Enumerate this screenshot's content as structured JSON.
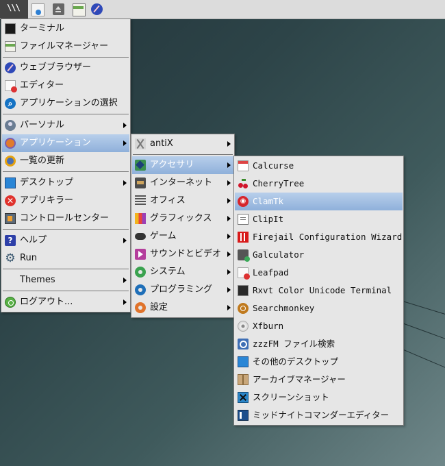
{
  "taskbar": {
    "start_icon": "menu-logo-icon",
    "launchers": [
      "file-manager-icon",
      "eject-icon",
      "terminal-launcher-icon",
      "browser-launcher-icon"
    ]
  },
  "main_menu": {
    "items": [
      {
        "label": "ターミナル",
        "icon": "terminal-icon"
      },
      {
        "label": "ファイルマネージャー",
        "icon": "file-manager-icon"
      },
      {
        "label": "ウェブブラウザー",
        "icon": "web-browser-icon"
      },
      {
        "label": "エディター",
        "icon": "editor-icon"
      },
      {
        "label": "アプリケーションの選択",
        "icon": "app-select-icon"
      },
      {
        "label": "パーソナル",
        "icon": "personal-icon"
      },
      {
        "label": "アプリケーション",
        "icon": "applications-icon"
      },
      {
        "label": "一覧の更新",
        "icon": "refresh-icon"
      },
      {
        "label": "デスクトップ",
        "icon": "desktop-icon"
      },
      {
        "label": "アプリキラー",
        "icon": "app-killer-icon"
      },
      {
        "label": "コントロールセンター",
        "icon": "control-center-icon"
      },
      {
        "label": "ヘルプ",
        "icon": "help-icon"
      },
      {
        "label": "Run",
        "icon": "run-gear-icon"
      },
      {
        "label": "Themes",
        "icon": ""
      },
      {
        "label": "ログアウト...",
        "icon": "logout-icon"
      }
    ]
  },
  "apps_menu": {
    "items": [
      {
        "label": "antiX",
        "icon": "antix-icon"
      },
      {
        "label": "アクセサリ",
        "icon": "accessories-icon"
      },
      {
        "label": "インターネット",
        "icon": "internet-icon"
      },
      {
        "label": "オフィス",
        "icon": "office-icon"
      },
      {
        "label": "グラフィックス",
        "icon": "graphics-icon"
      },
      {
        "label": "ゲーム",
        "icon": "games-icon"
      },
      {
        "label": "サウンドとビデオ",
        "icon": "sound-video-icon"
      },
      {
        "label": "システム",
        "icon": "system-icon"
      },
      {
        "label": "プログラミング",
        "icon": "programming-icon"
      },
      {
        "label": "設定",
        "icon": "settings-icon"
      }
    ]
  },
  "accessories_menu": {
    "items": [
      {
        "label": "Calcurse",
        "icon": "calendar-icon"
      },
      {
        "label": "CherryTree",
        "icon": "cherry-icon"
      },
      {
        "label": "ClamTk",
        "icon": "clamtk-icon"
      },
      {
        "label": "ClipIt",
        "icon": "clipboard-icon"
      },
      {
        "label": "Firejail Configuration Wizard",
        "icon": "firejail-icon"
      },
      {
        "label": "Galculator",
        "icon": "calculator-icon"
      },
      {
        "label": "Leafpad",
        "icon": "leafpad-icon"
      },
      {
        "label": "Rxvt Color Unicode Terminal",
        "icon": "rxvt-terminal-icon"
      },
      {
        "label": "Searchmonkey",
        "icon": "searchmonkey-icon"
      },
      {
        "label": "Xfburn",
        "icon": "disc-burn-icon"
      },
      {
        "label": "zzzFM ファイル検索",
        "icon": "file-search-icon"
      },
      {
        "label": "その他のデスクトップ",
        "icon": "other-desktop-icon"
      },
      {
        "label": "アーカイブマネージャー",
        "icon": "archive-icon"
      },
      {
        "label": "スクリーンショット",
        "icon": "screenshot-icon"
      },
      {
        "label": "ミッドナイトコマンダーエディター",
        "icon": "mc-editor-icon"
      }
    ]
  },
  "colors": {
    "highlight": "#9ab8df",
    "menu_bg": "#e6e6e6"
  }
}
